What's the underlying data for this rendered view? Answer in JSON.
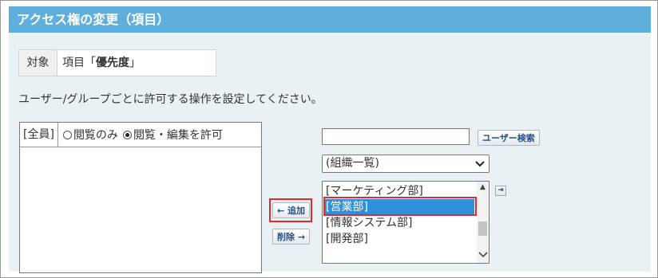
{
  "title": "アクセス権の変更（項目）",
  "target": {
    "label": "対象",
    "prefix": "項目「",
    "name": "優先度",
    "suffix": "」"
  },
  "instruction": "ユーザー/グループごとに許可する操作を設定してください。",
  "permission_panel": {
    "entry_name": "[全員]",
    "options": [
      {
        "label": "閲覧のみ",
        "selected": false
      },
      {
        "label": "閲覧・編集を許可",
        "selected": true
      }
    ]
  },
  "buttons": {
    "add": "← 追加",
    "remove": "削除 →",
    "user_search": "ユーザー検索"
  },
  "search": {
    "value": ""
  },
  "org_select": {
    "selected": "(組織一覧)"
  },
  "org_list": {
    "items": [
      {
        "label": "[マーケティング部]",
        "selected": false
      },
      {
        "label": "[営業部]",
        "selected": true
      },
      {
        "label": "[情報システム部]",
        "selected": false
      },
      {
        "label": "[開発部]",
        "selected": false
      }
    ]
  },
  "colors": {
    "header": "#5faedb",
    "background": "#eaf1f5",
    "highlight": "#e32a2a",
    "selection": "#2f8fd8"
  },
  "icons": {
    "move_right": "arrow-right-to-bar-icon",
    "dropdown": "chevron-down-icon"
  }
}
